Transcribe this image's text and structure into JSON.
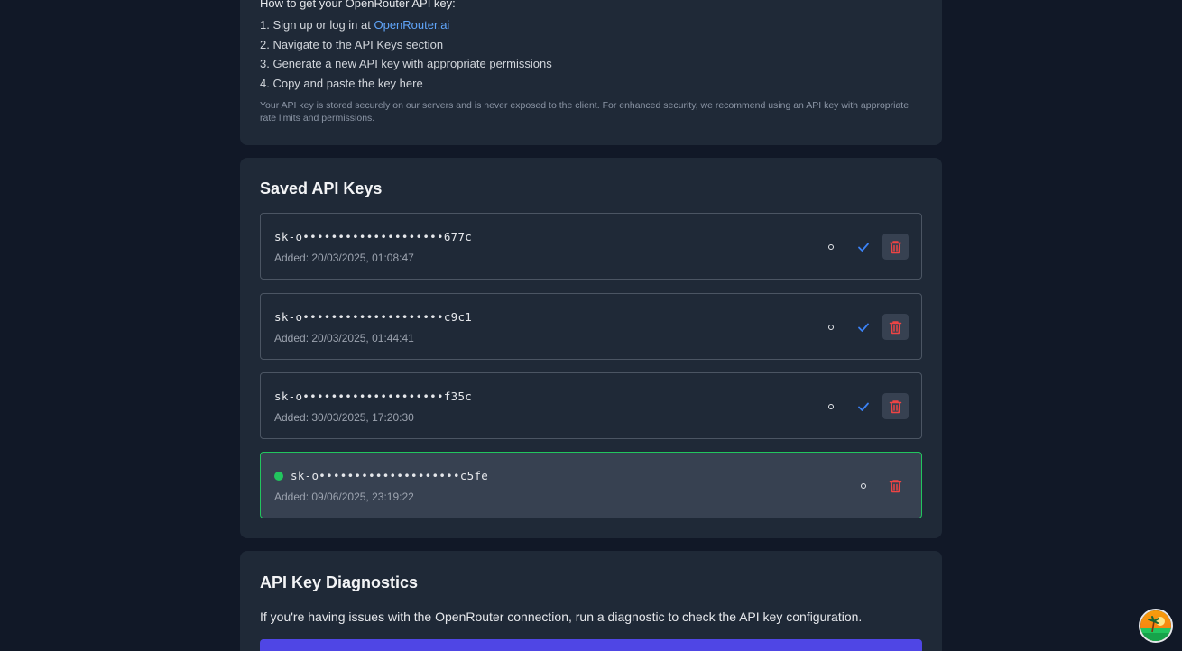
{
  "instructions": {
    "heading": "How to get your OpenRouter API key:",
    "steps": [
      {
        "prefix": "1. Sign up or log in at ",
        "link": "OpenRouter.ai"
      },
      {
        "text": "2. Navigate to the API Keys section"
      },
      {
        "text": "3. Generate a new API key with appropriate permissions"
      },
      {
        "text": "4. Copy and paste the key here"
      }
    ],
    "note": "Your API key is stored securely on our servers and is never exposed to the client. For enhanced security, we recommend using an API key with appropriate rate limits and permissions."
  },
  "saved_keys": {
    "title": "Saved API Keys",
    "keys": [
      {
        "masked": "sk-o••••••••••••••••••••677c",
        "added": "Added: 20/03/2025, 01:08:47",
        "active": false
      },
      {
        "masked": "sk-o••••••••••••••••••••c9c1",
        "added": "Added: 20/03/2025, 01:44:41",
        "active": false
      },
      {
        "masked": "sk-o••••••••••••••••••••f35c",
        "added": "Added: 30/03/2025, 17:20:30",
        "active": false
      },
      {
        "masked": "sk-o••••••••••••••••••••c5fe",
        "added": "Added: 09/06/2025, 23:19:22",
        "active": true
      }
    ],
    "icons": {
      "show": "eye-icon",
      "activate": "check-icon",
      "delete": "trash-icon"
    }
  },
  "diagnostics": {
    "title": "API Key Diagnostics",
    "description": "If you're having issues with the OpenRouter connection, run a diagnostic to check the API key configuration."
  },
  "colors": {
    "background": "#111827",
    "card": "#1f2937",
    "active_border": "#22c55e",
    "link": "#60a5fa",
    "check": "#3b82f6",
    "delete": "#ef4444",
    "primary_button": "#4f46e5"
  }
}
